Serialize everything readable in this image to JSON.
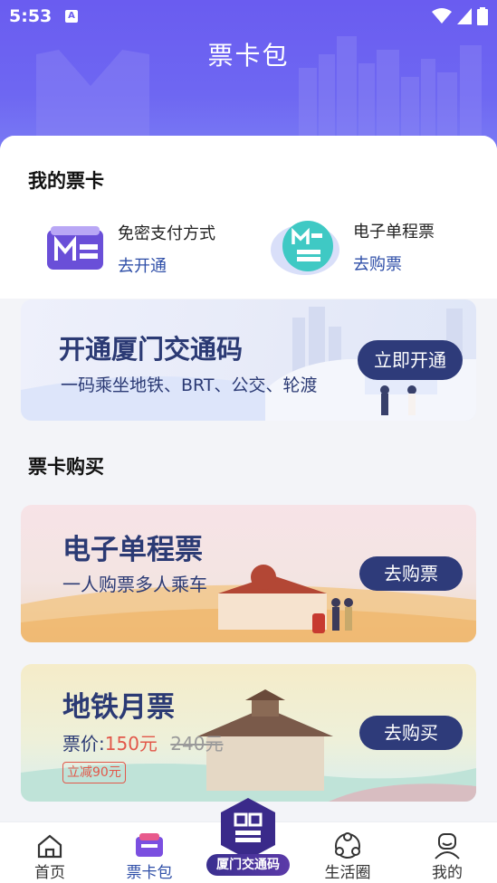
{
  "status_bar": {
    "time": "5:53"
  },
  "header": {
    "title": "票卡包"
  },
  "my_cards": {
    "section_title": "我的票卡",
    "items": [
      {
        "label": "免密支付方式",
        "action": "去开通",
        "icon": "card-m-icon"
      },
      {
        "label": "电子单程票",
        "action": "去购票",
        "icon": "token-icon"
      }
    ]
  },
  "promo_banner": {
    "title": "开通厦门交通码",
    "subtitle": "一码乘坐地铁、BRT、公交、轮渡",
    "button": "立即开通"
  },
  "purchase": {
    "section_title": "票卡购买",
    "single_ticket": {
      "title": "电子单程票",
      "subtitle": "一人购票多人乘车",
      "button": "去购票"
    },
    "monthly_pass": {
      "title": "地铁月票",
      "price_label": "票价:",
      "price": "150元",
      "original_price": "240元",
      "discount_badge": "立减90元",
      "button": "去购买"
    }
  },
  "tabbar": {
    "items": [
      {
        "label": "首页",
        "icon": "home-icon"
      },
      {
        "label": "票卡包",
        "icon": "wallet-icon"
      },
      {
        "label": "厦门交通码",
        "icon": "qr-code-icon"
      },
      {
        "label": "生活圈",
        "icon": "circle-icon"
      },
      {
        "label": "我的",
        "icon": "profile-icon"
      }
    ],
    "active": "票卡包"
  },
  "colors": {
    "header": "#6a5cf0",
    "accent": "#2f4fa8",
    "button_dark": "#2e3b7a",
    "price_red": "#e2584a"
  }
}
